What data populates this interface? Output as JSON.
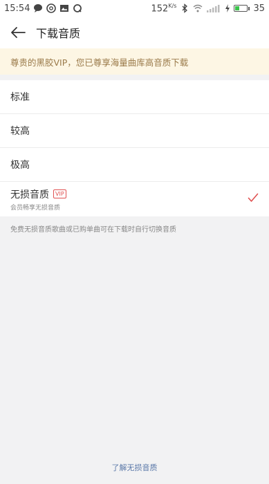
{
  "status_bar": {
    "time": "15:54",
    "speed": "152",
    "speed_unit": "K/s",
    "battery_level": "35"
  },
  "header": {
    "title": "下载音质"
  },
  "notice": {
    "text": "尊贵的黑胶VIP，您已尊享海量曲库高音质下载"
  },
  "options": [
    {
      "label": "标准"
    },
    {
      "label": "较高"
    },
    {
      "label": "极高"
    },
    {
      "label": "无损音质",
      "badge": "VIP",
      "sub": "会员畅享无损音质",
      "selected": true
    }
  ],
  "footnote": "免费无损音质歌曲或已购单曲可在下载时自行切换音质",
  "bottom_link": "了解无损音质",
  "colors": {
    "accent_red": "#e05050",
    "notice_bg": "#fdf6e4",
    "notice_text": "#9a7a4a",
    "link": "#5a78a8"
  }
}
